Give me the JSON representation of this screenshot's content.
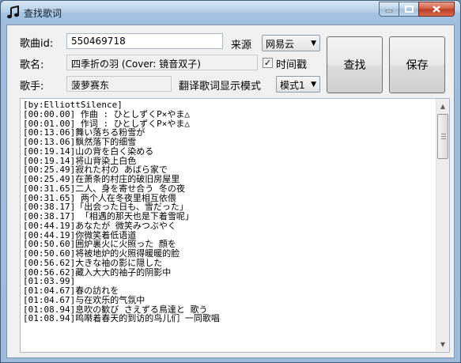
{
  "window": {
    "title": "查找歌词"
  },
  "form": {
    "song_id_label": "歌曲id:",
    "song_id_value": "550469718",
    "source_label": "来源",
    "source_value": "网易云",
    "song_name_label": "歌名:",
    "song_name_value": "四季折の羽 (Cover: 镜音双子)",
    "timestamp_label": "时间戳",
    "timestamp_checked": true,
    "singer_label": "歌手:",
    "singer_value": "菠萝赛东",
    "translate_mode_label": "翻译歌词显示模式",
    "translate_mode_value": "模式1"
  },
  "buttons": {
    "search": "查找",
    "save": "保存"
  },
  "lyrics": [
    "[by:ElliottSilence]",
    "[00:00.00] 作曲 : ひとしずくP×やま△",
    "[00:01.00] 作词 : ひとしずくP×やま△",
    "[00:13.06]舞い落ちる粉雪が",
    "[00:13.06]飘然落下的细雪",
    "[00:19.14]山の背を白く染める",
    "[00:19.14]将山背染上白色",
    "[00:25.49]寂れた村の あばら家で",
    "[00:25.49]在萧条的村庄的破旧房屋里",
    "[00:31.65]二人、身を寄せ合う 冬の夜",
    "[00:31.65] 两个人在冬夜里相互依偎",
    "[00:38.17]「出会った日も、雪だった」",
    "[00:38.17] 「相遇的那天也是下着雪呢」",
    "[00:44.19]あなたが 微笑みつぶやく",
    "[00:44.19]你微笑着低语道",
    "[00:50.60]囲炉裏火に火照った 顔を",
    "[00:50.60]将被地炉的火照得暖暖的脸",
    "[00:56.62]大きな袖の影に隠した",
    "[00:56.62]藏入大大的袖子的阴影中",
    "[01:03.99]",
    "[01:04.67]春の訪れを",
    "[01:04.67]与在欢乐的气氛中",
    "[01:08.94]息吹の歓び さえずる鳥達と 歌う",
    "[01:08.94]鸣啭着春天的到访的鸟儿们 一同歌唱"
  ]
}
